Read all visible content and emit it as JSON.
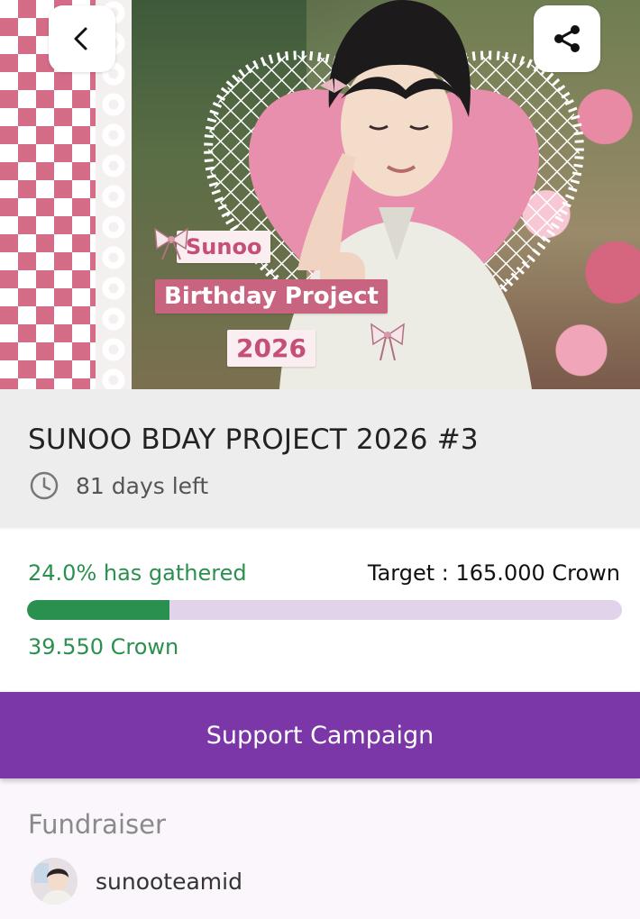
{
  "banner": {
    "label_name": "Sunoo",
    "label_project": "Birthday Project",
    "label_year": "2026"
  },
  "nav": {
    "back_icon": "chevron-left-icon",
    "share_icon": "share-icon"
  },
  "campaign": {
    "title": "SUNOO BDAY PROJECT 2026 #3",
    "days_left": "81 days left",
    "clock_icon": "clock-icon"
  },
  "progress": {
    "gathered_text": "24.0% has gathered",
    "percent": 24.0,
    "target_text": "Target : 165.000 Crown",
    "collected_text": "39.550 Crown"
  },
  "cta": {
    "support_label": "Support Campaign"
  },
  "fundraiser": {
    "heading": "Fundraiser",
    "name": "sunooteamid"
  },
  "colors": {
    "accent_purple": "#7b36a8",
    "progress_green": "#2a9050",
    "track": "#e1d3ea"
  }
}
